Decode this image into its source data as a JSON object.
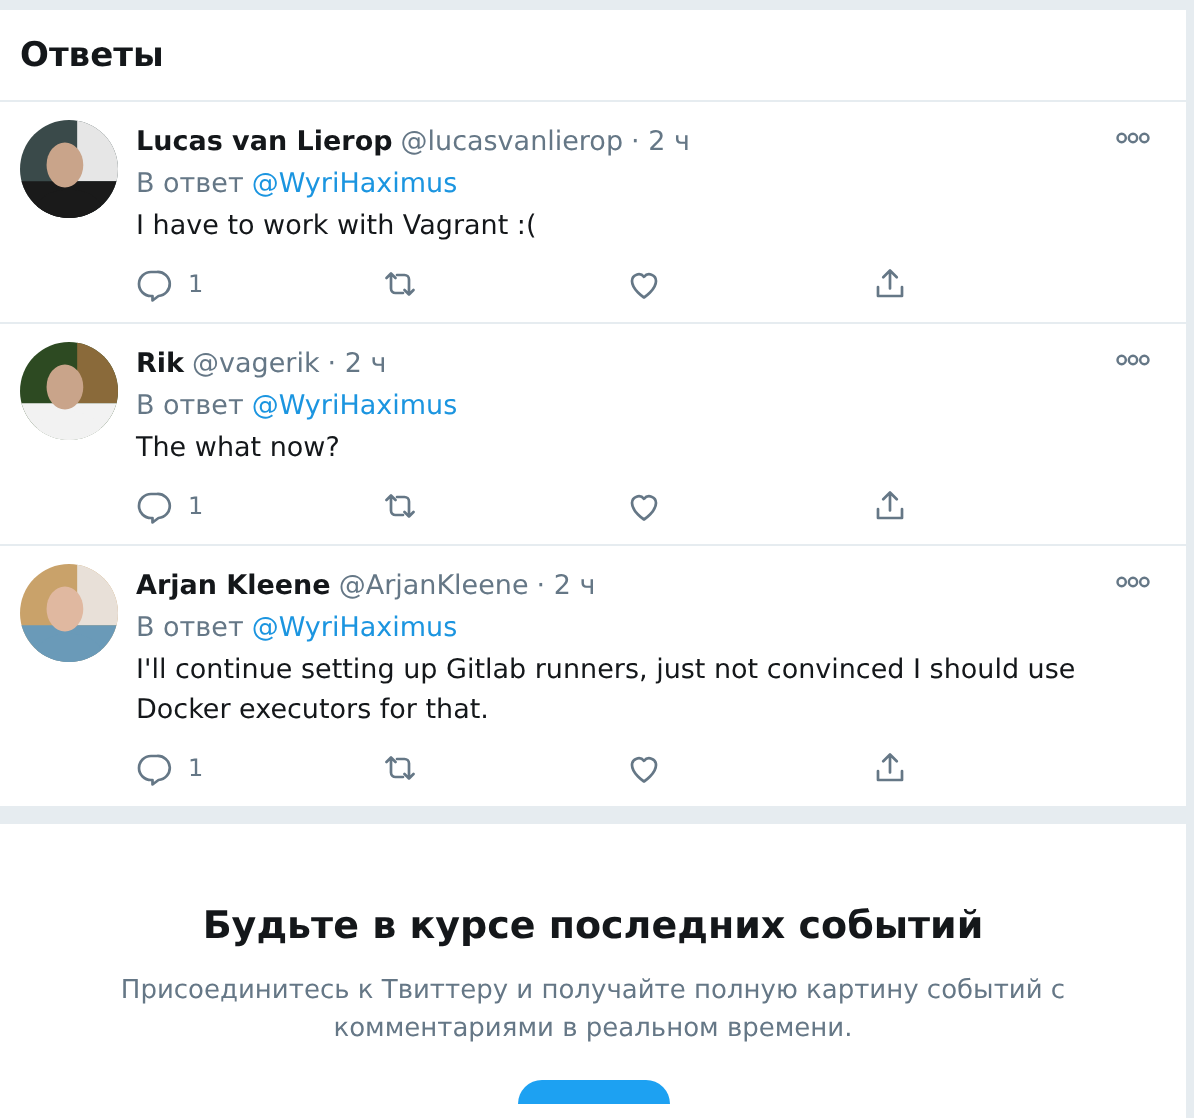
{
  "header": {
    "title": "Ответы"
  },
  "replies": [
    {
      "name": "Lucas van Lierop",
      "handle": "@lucasvanlierop",
      "time": "· 2 ч",
      "reply_prefix": "В ответ",
      "reply_to": "@WyriHaximus",
      "text": "I have to work with Vagrant :(",
      "reply_count": "1"
    },
    {
      "name": "Rik",
      "handle": "@vagerik",
      "time": "· 2 ч",
      "reply_prefix": "В ответ",
      "reply_to": "@WyriHaximus",
      "text": "The what now?",
      "reply_count": "1"
    },
    {
      "name": "Arjan Kleene",
      "handle": "@ArjanKleene",
      "time": "· 2 ч",
      "reply_prefix": "В ответ",
      "reply_to": "@WyriHaximus",
      "text": "I'll continue setting up Gitlab runners, just not convinced I should use Docker executors for that.",
      "reply_count": "1"
    }
  ],
  "promo": {
    "title": "Будьте в курсе последних событий",
    "text": "Присоединитесь к Твиттеру и получайте полную картину событий с комментариями в реальном времени."
  }
}
